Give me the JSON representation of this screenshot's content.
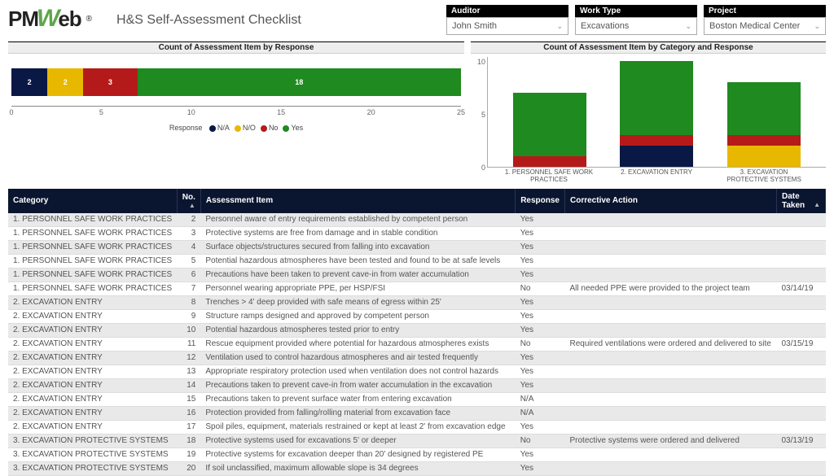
{
  "brand": {
    "p1": "PM",
    "w": "W",
    "p2": "eb",
    "reg": "®"
  },
  "page_title": "H&S Self-Assessment Checklist",
  "filters": {
    "auditor": {
      "label": "Auditor",
      "value": "John Smith"
    },
    "worktype": {
      "label": "Work Type",
      "value": "Excavations"
    },
    "project": {
      "label": "Project",
      "value": "Boston Medical Center"
    }
  },
  "colors": {
    "na": "#0a1845",
    "no_option": "#e8b800",
    "no": "#b51a1a",
    "yes": "#1f8a1f"
  },
  "chart_data": [
    {
      "type": "bar",
      "orientation": "horizontal_stacked",
      "title": "Count of Assessment Item by Response",
      "total": 25,
      "segments": [
        {
          "label": "N/A",
          "value": 2,
          "color_key": "na"
        },
        {
          "label": "N/O",
          "value": 2,
          "color_key": "no_option"
        },
        {
          "label": "No",
          "value": 3,
          "color_key": "no"
        },
        {
          "label": "Yes",
          "value": 18,
          "color_key": "yes"
        }
      ],
      "xticks": [
        0,
        5,
        10,
        15,
        20,
        25
      ],
      "legend_title": "Response",
      "legend": [
        "N/A",
        "N/O",
        "No",
        "Yes"
      ]
    },
    {
      "type": "bar",
      "subtype": "stacked",
      "title": "Count of Assessment Item by Category and Response",
      "ylim": [
        0,
        10
      ],
      "yticks": [
        0,
        5,
        10
      ],
      "categories": [
        "1. PERSONNEL SAFE WORK PRACTICES",
        "2. EXCAVATION ENTRY",
        "3. EXCAVATION PROTECTIVE SYSTEMS"
      ],
      "series": [
        {
          "name": "N/A",
          "color_key": "na",
          "values": [
            0,
            2,
            0
          ]
        },
        {
          "name": "N/O",
          "color_key": "no_option",
          "values": [
            0,
            0,
            2
          ]
        },
        {
          "name": "No",
          "color_key": "no",
          "values": [
            1,
            1,
            1
          ]
        },
        {
          "name": "Yes",
          "color_key": "yes",
          "values": [
            6,
            7,
            5
          ]
        }
      ]
    }
  ],
  "table": {
    "headers": {
      "category": "Category",
      "no": "No.",
      "item": "Assessment Item",
      "response": "Response",
      "corrective": "Corrective Action",
      "date": "Date Taken"
    },
    "rows": [
      {
        "cat": "1. PERSONNEL SAFE WORK PRACTICES",
        "no": "2",
        "item": "Personnel aware of entry requirements established by competent person",
        "resp": "Yes",
        "corr": "",
        "date": ""
      },
      {
        "cat": "1. PERSONNEL SAFE WORK PRACTICES",
        "no": "3",
        "item": "Protective systems are free from damage and in stable condition",
        "resp": "Yes",
        "corr": "",
        "date": ""
      },
      {
        "cat": "1. PERSONNEL SAFE WORK PRACTICES",
        "no": "4",
        "item": "Surface objects/structures secured from falling into excavation",
        "resp": "Yes",
        "corr": "",
        "date": ""
      },
      {
        "cat": "1. PERSONNEL SAFE WORK PRACTICES",
        "no": "5",
        "item": "Potential hazardous atmospheres have been tested and found to be at safe levels",
        "resp": "Yes",
        "corr": "",
        "date": ""
      },
      {
        "cat": "1. PERSONNEL SAFE WORK PRACTICES",
        "no": "6",
        "item": "Precautions have been taken to prevent cave-in from water accumulation",
        "resp": "Yes",
        "corr": "",
        "date": ""
      },
      {
        "cat": "1. PERSONNEL SAFE WORK PRACTICES",
        "no": "7",
        "item": "Personnel wearing appropriate PPE, per HSP/FSI",
        "resp": "No",
        "corr": "All needed PPE were provided to the project team",
        "date": "03/14/19"
      },
      {
        "cat": "2. EXCAVATION ENTRY",
        "no": "8",
        "item": "Trenches > 4' deep provided with safe means of egress within 25'",
        "resp": "Yes",
        "corr": "",
        "date": ""
      },
      {
        "cat": "2. EXCAVATION ENTRY",
        "no": "9",
        "item": "Structure ramps designed and approved by competent person",
        "resp": "Yes",
        "corr": "",
        "date": ""
      },
      {
        "cat": "2. EXCAVATION ENTRY",
        "no": "10",
        "item": "Potential hazardous atmospheres tested prior to entry",
        "resp": "Yes",
        "corr": "",
        "date": ""
      },
      {
        "cat": "2. EXCAVATION ENTRY",
        "no": "11",
        "item": "Rescue equipment provided where potential for hazardous atmospheres exists",
        "resp": "No",
        "corr": "Required ventilations were ordered and delivered to site",
        "date": "03/15/19"
      },
      {
        "cat": "2. EXCAVATION ENTRY",
        "no": "12",
        "item": "Ventilation used to control hazardous atmospheres and air tested frequently",
        "resp": "Yes",
        "corr": "",
        "date": ""
      },
      {
        "cat": "2. EXCAVATION ENTRY",
        "no": "13",
        "item": "Appropriate respiratory protection used when ventilation does not control hazards",
        "resp": "Yes",
        "corr": "",
        "date": ""
      },
      {
        "cat": "2. EXCAVATION ENTRY",
        "no": "14",
        "item": "Precautions taken to prevent cave-in from water accumulation in the excavation",
        "resp": "Yes",
        "corr": "",
        "date": ""
      },
      {
        "cat": "2. EXCAVATION ENTRY",
        "no": "15",
        "item": "Precautions taken to prevent surface water from entering excavation",
        "resp": "N/A",
        "corr": "",
        "date": ""
      },
      {
        "cat": "2. EXCAVATION ENTRY",
        "no": "16",
        "item": "Protection provided from falling/rolling material from excavation face",
        "resp": "N/A",
        "corr": "",
        "date": ""
      },
      {
        "cat": "2. EXCAVATION ENTRY",
        "no": "17",
        "item": "Spoil piles, equipment, materials restrained or kept at least 2' from excavation edge",
        "resp": "Yes",
        "corr": "",
        "date": ""
      },
      {
        "cat": "3. EXCAVATION PROTECTIVE SYSTEMS",
        "no": "18",
        "item": "Protective systems used for excavations 5' or deeper",
        "resp": "No",
        "corr": "Protective systems were ordered and delivered",
        "date": "03/13/19"
      },
      {
        "cat": "3. EXCAVATION PROTECTIVE SYSTEMS",
        "no": "19",
        "item": "Protective systems for excavation deeper than 20' designed by registered PE",
        "resp": "Yes",
        "corr": "",
        "date": ""
      },
      {
        "cat": "3. EXCAVATION PROTECTIVE SYSTEMS",
        "no": "20",
        "item": "If soil unclassified, maximum allowable slope is 34 degrees",
        "resp": "Yes",
        "corr": "",
        "date": ""
      }
    ]
  }
}
